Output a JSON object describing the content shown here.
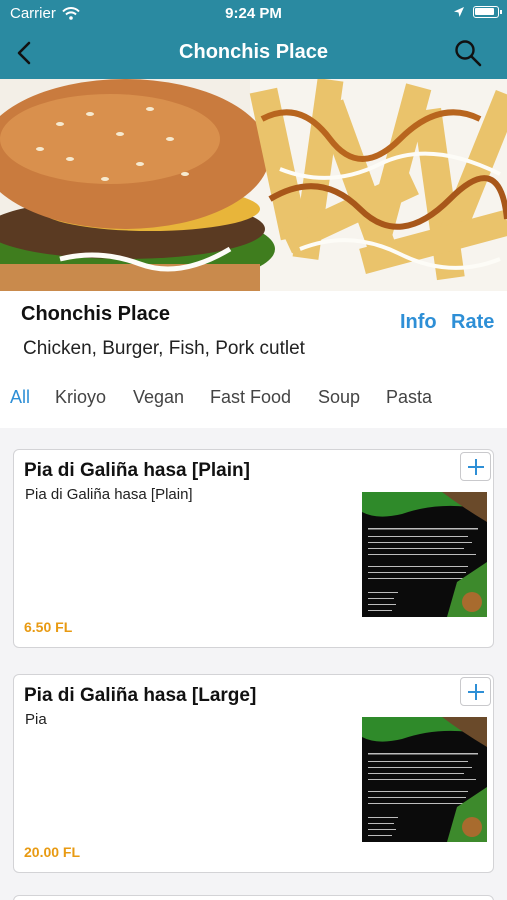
{
  "status": {
    "carrier": "Carrier",
    "time": "9:24 PM"
  },
  "nav": {
    "title": "Chonchis Place"
  },
  "restaurant": {
    "name": "Chonchis Place",
    "tags": "Chicken, Burger, Fish, Pork cutlet",
    "info_label": "Info",
    "rate_label": "Rate"
  },
  "tabs": [
    "All",
    "Krioyo",
    "Vegan",
    "Fast Food",
    "Soup",
    "Pasta"
  ],
  "items": [
    {
      "title": "Pia di Galiña hasa [Plain]",
      "description": "Pia di Galiña hasa [Plain]",
      "price": "6.50 FL"
    },
    {
      "title": "Pia di Galiña hasa [Large]",
      "description": "Pia",
      "price": "20.00 FL"
    }
  ],
  "colors": {
    "header": "#2a8aa1",
    "accent": "#2e8fd6",
    "price": "#e89a12"
  }
}
